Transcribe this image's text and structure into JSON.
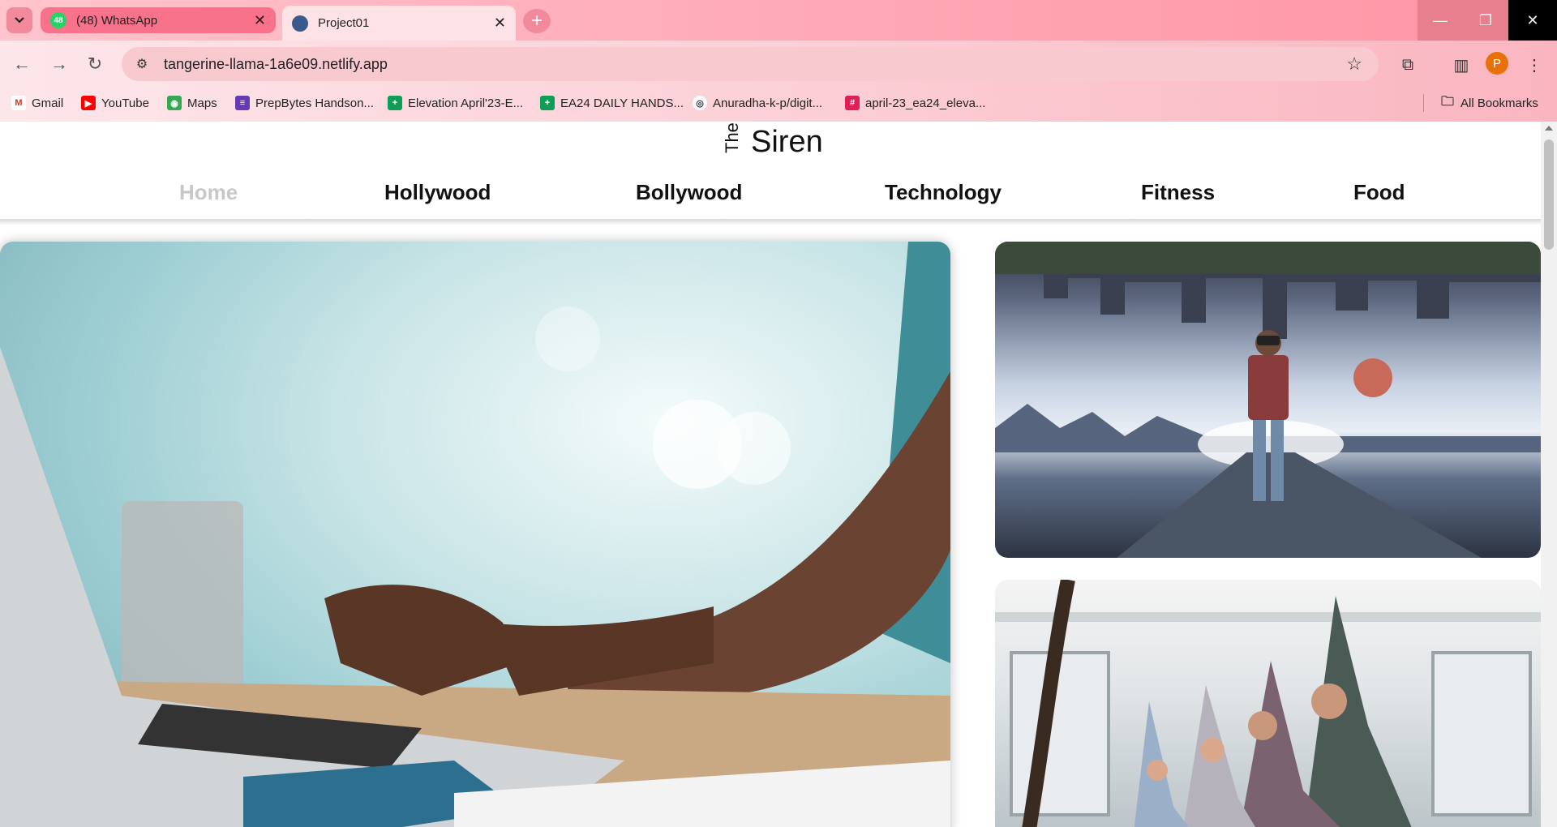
{
  "browser": {
    "tabs": [
      {
        "title": "(48) WhatsApp",
        "badge": "48",
        "active": false
      },
      {
        "title": "Project01",
        "active": true
      }
    ],
    "url": "tangerine-llama-1a6e09.netlify.app",
    "profile_initial": "P",
    "bookmarks": [
      {
        "label": "Gmail",
        "icon": "gmail-icon"
      },
      {
        "label": "YouTube",
        "icon": "youtube-icon"
      },
      {
        "label": "Maps",
        "icon": "maps-icon"
      },
      {
        "label": "PrepBytes Handson...",
        "icon": "prepbytes-icon"
      },
      {
        "label": "Elevation April'23-E...",
        "icon": "sheets-icon"
      },
      {
        "label": "EA24 DAILY HANDS...",
        "icon": "sheets-icon"
      },
      {
        "label": "Anuradha-k-p/digit...",
        "icon": "github-icon"
      },
      {
        "label": "april-23_ea24_eleva...",
        "icon": "slack-icon"
      }
    ],
    "all_bookmarks": "All Bookmarks"
  },
  "site": {
    "brand_small": "The",
    "brand_large": "Siren",
    "nav": [
      {
        "label": "Home",
        "active": true
      },
      {
        "label": "Hollywood",
        "active": false
      },
      {
        "label": "Bollywood",
        "active": false
      },
      {
        "label": "Technology",
        "active": false
      },
      {
        "label": "Fitness",
        "active": false
      },
      {
        "label": "Food",
        "active": false
      }
    ]
  },
  "colors": {
    "accent": "#f28a9b",
    "nav_active": "#c8c8c8",
    "profile": "#e8710a"
  }
}
